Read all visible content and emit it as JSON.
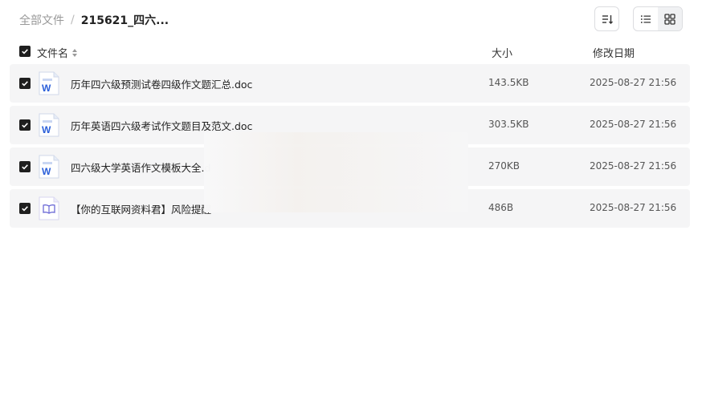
{
  "breadcrumb": {
    "root": "全部文件",
    "separator": "/",
    "current": "215621_四六..."
  },
  "toolbar": {
    "sort_icon": "sort-lines-icon",
    "list_view_icon": "list-view-icon",
    "grid_view_icon": "grid-view-icon",
    "active_view": "list"
  },
  "table": {
    "headers": {
      "name": "文件名",
      "size": "大小",
      "modified": "修改日期"
    },
    "rows": [
      {
        "name": "历年四六级预测试卷四级作文题汇总.doc",
        "size": "143.5KB",
        "modified": "2025-08-27 21:56",
        "icon": "word-doc-icon",
        "checked": true
      },
      {
        "name": "历年英语四六级考试作文题目及范文.doc",
        "size": "303.5KB",
        "modified": "2025-08-27 21:56",
        "icon": "word-doc-icon",
        "checked": true
      },
      {
        "name": "四六级大学英语作文模板大全.d",
        "size": "270KB",
        "modified": "2025-08-27 21:56",
        "icon": "word-doc-icon",
        "checked": true
      },
      {
        "name": "【你的互联网资料君】风险提醒",
        "size": "486B",
        "modified": "2025-08-27 21:56",
        "icon": "book-file-icon",
        "checked": true
      }
    ]
  },
  "colors": {
    "row_bg": "#f5f5f6",
    "word_blue": "#2b5fd9",
    "book_purple": "#6c6ad6",
    "checkbox": "#1f1f1f"
  }
}
